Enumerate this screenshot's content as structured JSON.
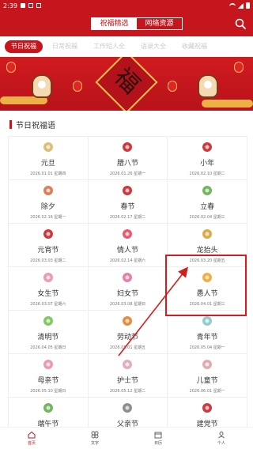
{
  "status_bar": {
    "time": "2:39"
  },
  "header": {
    "tabs": [
      {
        "label": "祝福精选",
        "active": true
      },
      {
        "label": "网络资源",
        "active": false
      }
    ]
  },
  "categories": [
    {
      "label": "节日祝福",
      "active": true
    },
    {
      "label": "日常祝福",
      "active": false
    },
    {
      "label": "工作短人全",
      "active": false
    },
    {
      "label": "语录大全",
      "active": false
    },
    {
      "label": "收藏祝福",
      "active": false
    }
  ],
  "banner": {
    "character": "福"
  },
  "section": {
    "title": "节日祝福语"
  },
  "festivals": [
    {
      "name": "元旦",
      "date": "2026.01.01 星期四",
      "icon": "calendar-one-icon",
      "color": "#d8b35a"
    },
    {
      "name": "腊八节",
      "date": "2026.01.26 星期一",
      "icon": "porridge-bowl-icon",
      "color": "#c4161c"
    },
    {
      "name": "小年",
      "date": "2026.02.10 星期二",
      "icon": "calendar-year-icon",
      "color": "#c4161c"
    },
    {
      "name": "除夕",
      "date": "2026.02.16 星期一",
      "icon": "firecracker-icon",
      "color": "#d46a3c"
    },
    {
      "name": "春节",
      "date": "2026.02.17 星期二",
      "icon": "dumpling-icon",
      "color": "#c4161c"
    },
    {
      "name": "立春",
      "date": "2026.02.04 星期三",
      "icon": "sprout-icon",
      "color": "#5aa844"
    },
    {
      "name": "元宵节",
      "date": "2026.03.03 星期二",
      "icon": "lantern-icon",
      "color": "#c4161c"
    },
    {
      "name": "情人节",
      "date": "2026.02.14 星期六",
      "icon": "heart-arrow-icon",
      "color": "#e63c5a"
    },
    {
      "name": "龙抬头",
      "date": "2026.03.20 星期五",
      "icon": "dragon-head-icon",
      "color": "#d89a2a"
    },
    {
      "name": "女生节",
      "date": "2026.03.07 星期六",
      "icon": "flower-icon",
      "color": "#e88aa5"
    },
    {
      "name": "妇女节",
      "date": "2026.03.08 星期日",
      "icon": "high-heel-icon",
      "color": "#e06b9a"
    },
    {
      "name": "愚人节",
      "date": "2026.04.01 星期三",
      "icon": "smiley-icon",
      "color": "#f0a020"
    },
    {
      "name": "清明节",
      "date": "2026.04.05 星期日",
      "icon": "willow-icon",
      "color": "#6cbf4a"
    },
    {
      "name": "劳动节",
      "date": "2026.05.01 星期五",
      "icon": "worker-icon",
      "color": "#e07a20"
    },
    {
      "name": "青年节",
      "date": "2026.05.04 星期一",
      "icon": "youth-icon",
      "color": "#7ec6c0"
    },
    {
      "name": "母亲节",
      "date": "2026.05.10 星期日",
      "icon": "mother-icon",
      "color": "#e88aa5"
    },
    {
      "name": "护士节",
      "date": "2026.05.12 星期二",
      "icon": "nurse-icon",
      "color": "#d8a0b8"
    },
    {
      "name": "儿童节",
      "date": "2026.06.01 星期一",
      "icon": "child-icon",
      "color": "#d8a0a0"
    },
    {
      "name": "端午节",
      "date": "",
      "icon": "zongzi-icon",
      "color": "#5aa844"
    },
    {
      "name": "父亲节",
      "date": "",
      "icon": "father-icon",
      "color": "#7a7a7a"
    },
    {
      "name": "建党节",
      "date": "",
      "icon": "party-icon",
      "color": "#c4161c"
    }
  ],
  "bottom_nav": [
    {
      "label": "首页",
      "icon": "home-icon",
      "active": true
    },
    {
      "label": "文字",
      "icon": "grid-icon",
      "active": false
    },
    {
      "label": "日历",
      "icon": "calendar-icon",
      "active": false
    },
    {
      "label": "个人",
      "icon": "user-icon",
      "active": false
    }
  ]
}
